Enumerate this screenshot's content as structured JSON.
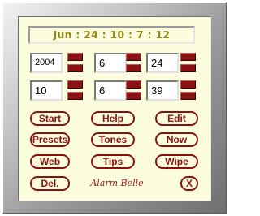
{
  "display": {
    "text": "Jun : 24 : 10 : 7 : 12"
  },
  "fields": {
    "year": "2004",
    "month": "6",
    "day": "24",
    "hour": "10",
    "minute": "6",
    "second": "39"
  },
  "buttons": {
    "start": "Start",
    "help": "Help",
    "edit": "Edit",
    "presets": "Presets",
    "tones": "Tones",
    "now": "Now",
    "web": "Web",
    "tips": "Tips",
    "wipe": "Wipe",
    "del": "Del.",
    "close": "X"
  },
  "brand": {
    "text": "Alarm Belle"
  },
  "colors": {
    "accent": "#8a1010",
    "panel": "#fcfcdf",
    "display_text": "#8e8810"
  }
}
